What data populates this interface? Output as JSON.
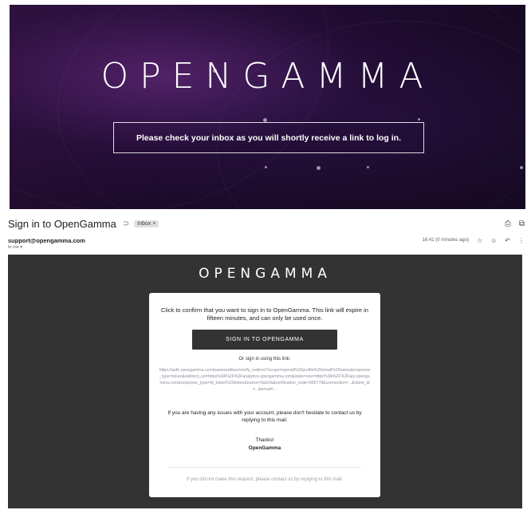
{
  "hero": {
    "logo": "OPENGAMMA",
    "message": "Please check your inbox as you will shortly receive a link to log in."
  },
  "email": {
    "subject": "Sign in to OpenGamma",
    "label": "Inbox ×",
    "sender": "support@opengamma.com",
    "to": "to me ▾",
    "time": "16:41 (0 minutes ago)",
    "icons": {
      "important": "importance-marker-icon",
      "print": "print-icon",
      "open_new": "open-in-new-window-icon",
      "star": "star-icon",
      "emoji": "emoji-reaction-icon",
      "reply": "reply-icon",
      "more": "more-options-icon"
    }
  },
  "body": {
    "logo": "OPENGAMMA",
    "intro": "Click to confirm that you want to sign in to OpenGamma. This link will expire in fifteen minutes, and can only be used once.",
    "cta": "SIGN IN TO OPENGAMMA",
    "or_text": "Or sign in using this link:",
    "link": "https://auth.opengamma.com/passwordless/verify_redirect?scope=openid%20profile%20email%20name&response_type=token&redirect_uri=https%3A%2F%2Fanalytics.opengamma.com&state=xxx=https%3A%2F%2Fapi.opengamma.com&response_type=id_token%20token&nonce=5a9cfa&verification_code=985778&connection=...&client_id=...&email=...",
    "issues": "If you are having any issues with your account, please don't hesitate to contact us by replying to this mail.",
    "thanks": "Thanks!",
    "signoff": "OpenGamma",
    "footnote": "If you did not make this request, please contact us by replying to this mail."
  }
}
